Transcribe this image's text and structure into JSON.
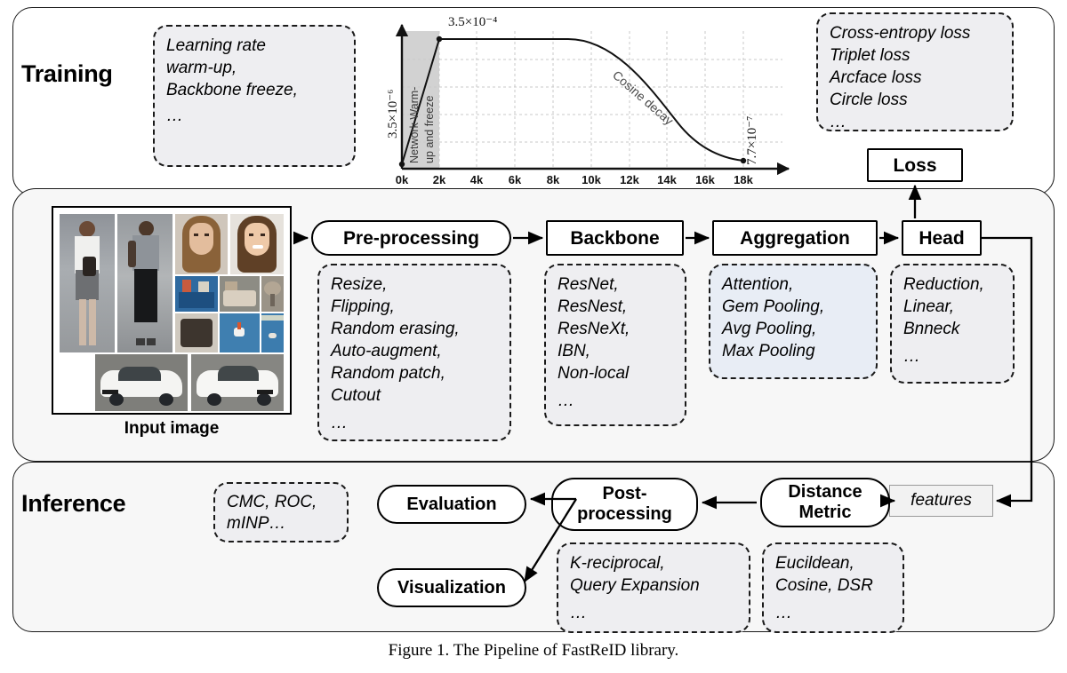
{
  "figure": {
    "caption": "Figure 1. The Pipeline of FastReID library."
  },
  "panels": {
    "training": {
      "title": "Training"
    },
    "inference": {
      "title": "Inference"
    }
  },
  "training": {
    "options_box": {
      "lines": [
        "Learning rate",
        "warm-up,",
        "Backbone freeze,",
        "…"
      ]
    },
    "loss_options_box": {
      "lines": [
        "Cross-entropy loss",
        "Triplet loss",
        "Arcface loss",
        "Circle loss",
        "…"
      ]
    },
    "loss_node": {
      "label": "Loss"
    }
  },
  "pipeline": {
    "input": {
      "caption": "Input image"
    },
    "nodes": [
      {
        "name": "pre-processing",
        "label": "Pre-processing",
        "shape": "pill"
      },
      {
        "name": "backbone",
        "label": "Backbone",
        "shape": "rect"
      },
      {
        "name": "aggregation",
        "label": "Aggregation",
        "shape": "rect"
      },
      {
        "name": "head",
        "label": "Head",
        "shape": "rect"
      }
    ],
    "preprocessing_options": {
      "lines": [
        "Resize,",
        "Flipping,",
        "Random erasing,",
        "Auto-augment,",
        "Random patch,",
        "Cutout",
        "",
        "…"
      ]
    },
    "backbone_options": {
      "lines": [
        "ResNet,",
        "ResNest,",
        "ResNeXt,",
        "IBN,",
        "Non-local",
        "",
        "…"
      ]
    },
    "aggregation_options": {
      "lines": [
        "Attention,",
        "Gem Pooling,",
        "Avg Pooling,",
        "Max Pooling"
      ]
    },
    "head_options": {
      "lines": [
        "Reduction,",
        "Linear,",
        "Bnneck",
        "",
        "…"
      ]
    }
  },
  "inference": {
    "features_box": {
      "label": "features"
    },
    "nodes": [
      {
        "name": "distance-metric",
        "label": "Distance\nMetric",
        "shape": "pill"
      },
      {
        "name": "post-processing",
        "label": "Post-\nprocessing",
        "shape": "pill"
      },
      {
        "name": "evaluation",
        "label": "Evaluation",
        "shape": "pill"
      },
      {
        "name": "visualization",
        "label": "Visualization",
        "shape": "pill"
      }
    ],
    "distance_options": {
      "lines": [
        "Eucildean,",
        "Cosine, DSR",
        "",
        "…"
      ]
    },
    "postprocessing_options": {
      "lines": [
        "K-reciprocal,",
        "Query Expansion",
        "",
        "…"
      ]
    },
    "evaluation_options": {
      "lines": [
        "CMC, ROC,",
        "mINP…"
      ]
    }
  },
  "chart_data": {
    "type": "line",
    "title": "",
    "xlabel": "",
    "ylabel": "",
    "x_ticks": [
      "0k",
      "2k",
      "4k",
      "6k",
      "8k",
      "10k",
      "12k",
      "14k",
      "16k",
      "18k"
    ],
    "x_tick_values": [
      0,
      2000,
      4000,
      6000,
      8000,
      10000,
      12000,
      14000,
      16000,
      18000
    ],
    "xlim": [
      0,
      18800
    ],
    "annotations": [
      {
        "name": "peak-lr-label",
        "text": "3.5×10⁻⁴",
        "at_x": 2000
      },
      {
        "name": "start-lr-label",
        "text": "3.5×10⁻⁶",
        "at_x": 0,
        "rotated": true
      },
      {
        "name": "end-lr-label",
        "text": "7.7×10⁻⁷",
        "at_x": 18000,
        "rotated": true
      },
      {
        "name": "cosine-decay-label",
        "text": "Cosine decay",
        "rotated": true
      },
      {
        "name": "warmup-region-label",
        "text": "Network Warm-\nup and freeze",
        "rotated": true
      }
    ],
    "series": [
      {
        "name": "learning rate schedule",
        "points": [
          {
            "x": 0,
            "y": 0.035
          },
          {
            "x": 2000,
            "y": 1.0
          },
          {
            "x": 8800,
            "y": 1.0
          },
          {
            "x": 18000,
            "y": 0.055
          }
        ],
        "segments": [
          "linear warm-up 0k→2k",
          "constant plateau 2k→8.8k",
          "cosine decay 8.8k→18k"
        ]
      }
    ],
    "warmup_region": {
      "from": 0,
      "to": 2000,
      "fill": "#d2d2d2"
    },
    "grid": true,
    "legend": "none"
  },
  "colors": {
    "panel_training_bg": "#ffffff",
    "panel_body_bg": "#f7f7f7",
    "optbox_bg": "#eeeef1",
    "optbox_blue_bg": "#e8edf5",
    "stroke": "#1a1a1a",
    "warmup_fill": "#d2d2d2"
  }
}
